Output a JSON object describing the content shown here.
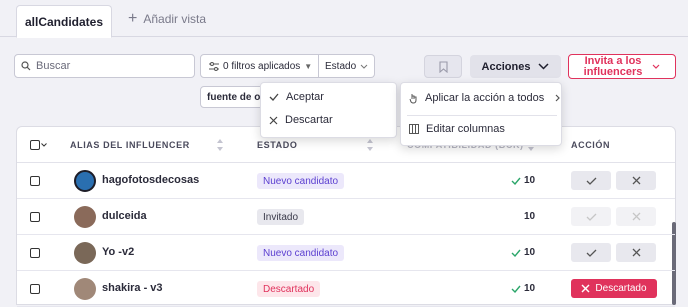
{
  "tabs": {
    "active": "allCandidates",
    "add_view": "Añadir vista"
  },
  "toolbar": {
    "search_placeholder": "Buscar",
    "filters_label": "0 filtros aplicados",
    "estado_label": "Estado",
    "fuente_chip": "fuente de origen",
    "acciones_label": "Acciones",
    "invite_label_1": "Invita a los",
    "invite_label_2": "influencers"
  },
  "estado_menu": {
    "accept": "Aceptar",
    "discard": "Descartar"
  },
  "acciones_menu": {
    "apply_all": "Aplicar la acción a todos",
    "edit_columns": "Editar columnas"
  },
  "table": {
    "headers": {
      "alias": "ALIAS DEL INFLUENCER",
      "estado": "ESTADO",
      "score": "COMPATIBILIDAD (BCK)",
      "accion": "ACCIÓN"
    },
    "rows": [
      {
        "alias": "hagofotosdecosas",
        "status": "Nuevo candidato",
        "score": "10",
        "score_check": true,
        "action": "buttons",
        "avatar_color": "#2a6fb0"
      },
      {
        "alias": "dulceida",
        "status": "Invitado",
        "score": "10",
        "score_check": false,
        "action": "buttons-disabled",
        "avatar_color": "#8a6a5a"
      },
      {
        "alias": "Yo -v2",
        "status": "Nuevo candidato",
        "score": "10",
        "score_check": true,
        "action": "buttons",
        "avatar_color": "#7a6858"
      },
      {
        "alias": "shakira - v3",
        "status": "Descartado",
        "score": "10",
        "score_check": true,
        "action": "discarded",
        "discarded_label": "Descartado",
        "avatar_color": "#a08878"
      }
    ]
  },
  "colors": {
    "accent": "#e0325c",
    "nuevo": "#5b3fd0",
    "check": "#2ba66a"
  }
}
